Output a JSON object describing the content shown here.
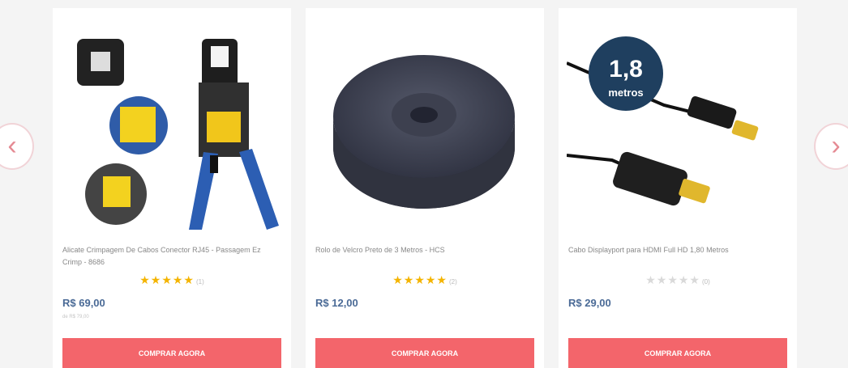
{
  "carousel": {
    "prev_label": "‹",
    "next_label": "›"
  },
  "products": [
    {
      "name": "Alicate Crimpagem De Cabos Conector RJ45 - Passagem Ez Crimp - 8686",
      "rating": 5,
      "stars_filled": "★★★★★",
      "stars_empty": "",
      "rating_count": "(1)",
      "price": "R$ 69,00",
      "old_price": "de R$ 79,00",
      "button": "COMPRAR AGORA",
      "image_icon": "crimping-tool-icon"
    },
    {
      "name": "Rolo de Velcro Preto de 3 Metros - HCS",
      "rating": 4.5,
      "stars_filled": "★★★★★",
      "stars_empty": "",
      "rating_count": "(2)",
      "price": "R$ 12,00",
      "old_price": "",
      "button": "COMPRAR AGORA",
      "image_icon": "velcro-roll-icon"
    },
    {
      "name": "Cabo Displayport para HDMI Full HD 1,80 Metros",
      "rating": 0,
      "stars_filled": "",
      "stars_empty": "★★★★★",
      "rating_count": "(0)",
      "price": "R$ 29,00",
      "old_price": "",
      "button": "COMPRAR AGORA",
      "image_icon": "displayport-hdmi-cable-icon",
      "image_badge": {
        "big": "1,8",
        "small": "metros"
      }
    }
  ]
}
